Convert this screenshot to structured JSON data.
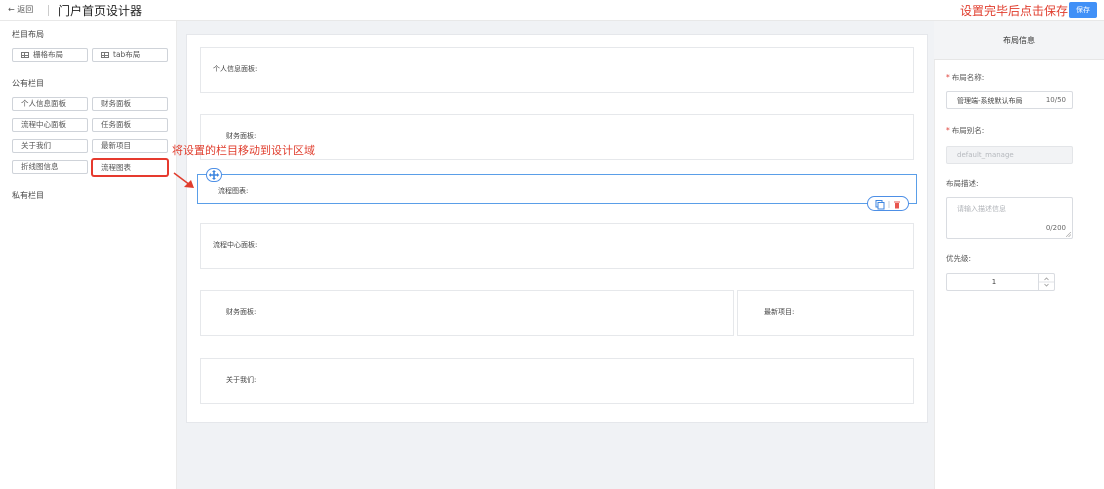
{
  "header": {
    "back_label": "← 返回",
    "title": "门户首页设计器",
    "save_hint": "设置完毕后点击保存",
    "save_label": "保存"
  },
  "sidebar": {
    "layout_section_title": "栏目布局",
    "layout_items": [
      "栅格布局",
      "tab布局"
    ],
    "public_section_title": "公有栏目",
    "public_items": [
      "个人信息面板",
      "财务面板",
      "流程中心面板",
      "任务面板",
      "关于我们",
      "最新项目",
      "折线图信息",
      "流程图表"
    ],
    "private_section_title": "私有栏目"
  },
  "annotation": {
    "drag_hint": "将设置的栏目移动到设计区域"
  },
  "canvas": {
    "panels": {
      "personal_info": "个人信息面板:",
      "finance": "财务面板:",
      "flow_chart": "流程图表:",
      "process_center": "流程中心面板:",
      "finance_2": "财务面板:",
      "latest_projects": "最新项目:",
      "about_us": "关于我们:"
    }
  },
  "right_panel": {
    "title": "布局信息",
    "name_label": "布局名称:",
    "name_value": "管理端-系统默认布局",
    "name_count": "10/50",
    "alias_label": "布局别名:",
    "alias_value": "default_manage",
    "desc_label": "布局描述:",
    "desc_placeholder": "请输入描述信息",
    "desc_count": "0/200",
    "priority_label": "优先级:",
    "priority_value": "1"
  },
  "colors": {
    "accent": "#4090f7",
    "annotation": "#e03d2d",
    "selected_border": "#5a9ee8"
  }
}
